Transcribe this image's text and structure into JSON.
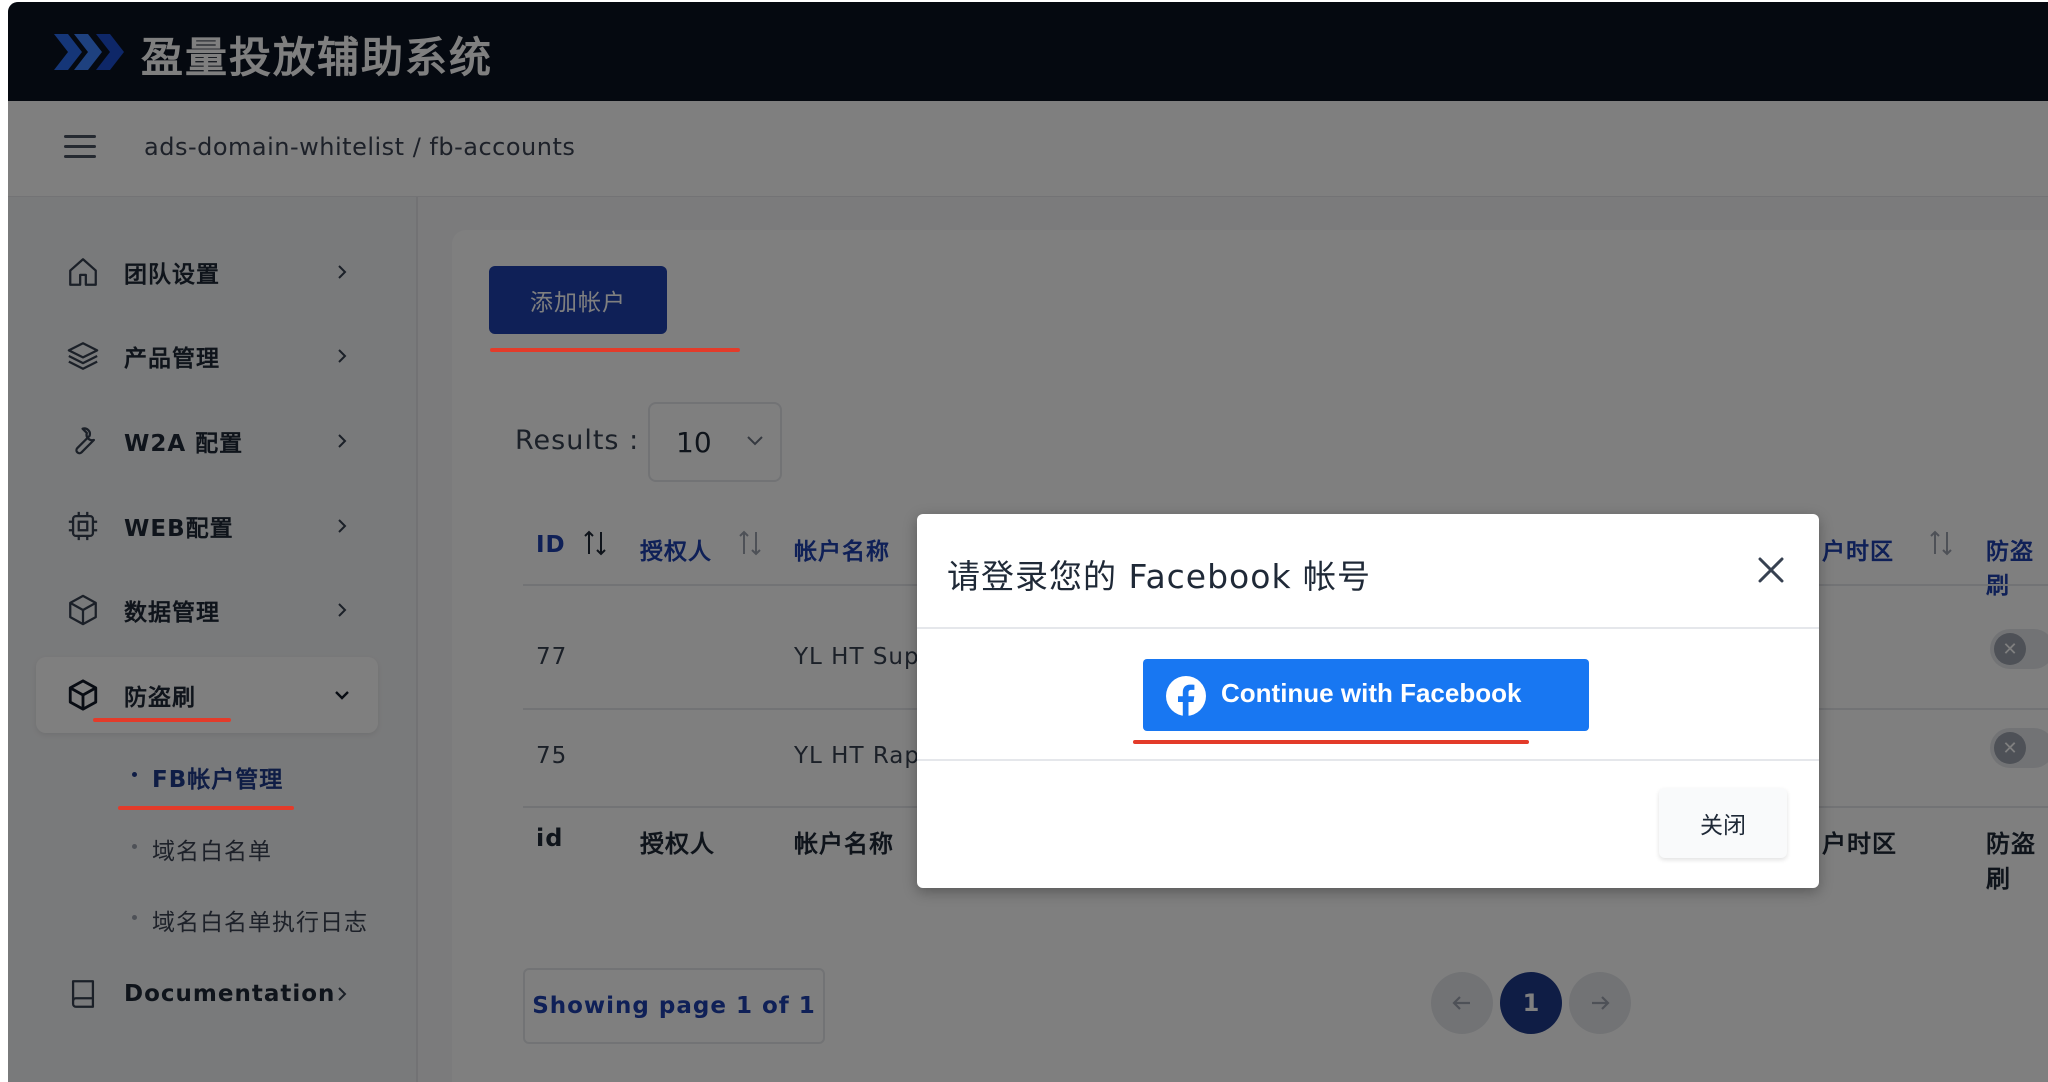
{
  "app": {
    "title": "盈量投放辅助系统"
  },
  "header": {
    "breadcrumb": "ads-domain-whitelist / fb-accounts"
  },
  "sidebar": {
    "items": [
      {
        "label": "团队设置",
        "icon": "home-icon"
      },
      {
        "label": "产品管理",
        "icon": "layers-icon"
      },
      {
        "label": "W2A 配置",
        "icon": "wrench-icon"
      },
      {
        "label": "WEB配置",
        "icon": "chip-icon"
      },
      {
        "label": "数据管理",
        "icon": "cube-icon"
      },
      {
        "label": "防盗刷",
        "icon": "cube-icon"
      },
      {
        "label": "Documentation",
        "icon": "book-icon"
      }
    ],
    "sub_items": [
      {
        "label": "FB帐户管理"
      },
      {
        "label": "域名白名单"
      },
      {
        "label": "域名白名单执行日志"
      }
    ]
  },
  "main": {
    "add_button_label": "添加帐户",
    "results_label": "Results :",
    "results_value": "10",
    "table": {
      "headers": [
        "ID",
        "授权人",
        "帐户名称",
        "户时区",
        "防盗刷"
      ],
      "rows": [
        {
          "id": "77",
          "name": "YL HT Sup"
        },
        {
          "id": "75",
          "name": "YL HT Rap"
        }
      ],
      "footer": [
        "id",
        "授权人",
        "帐户名称",
        "户时区",
        "防盗刷"
      ]
    },
    "pagination": {
      "info": "Showing page 1 of 1",
      "current": "1"
    }
  },
  "modal": {
    "title": "请登录您的 Facebook 帐号",
    "fb_button_label": "Continue with Facebook",
    "close_button_label": "关闭"
  },
  "colors": {
    "primary": "#1e40af",
    "facebook": "#1877f2",
    "annotation": "#e33b2a",
    "topbar": "#0b1220"
  }
}
